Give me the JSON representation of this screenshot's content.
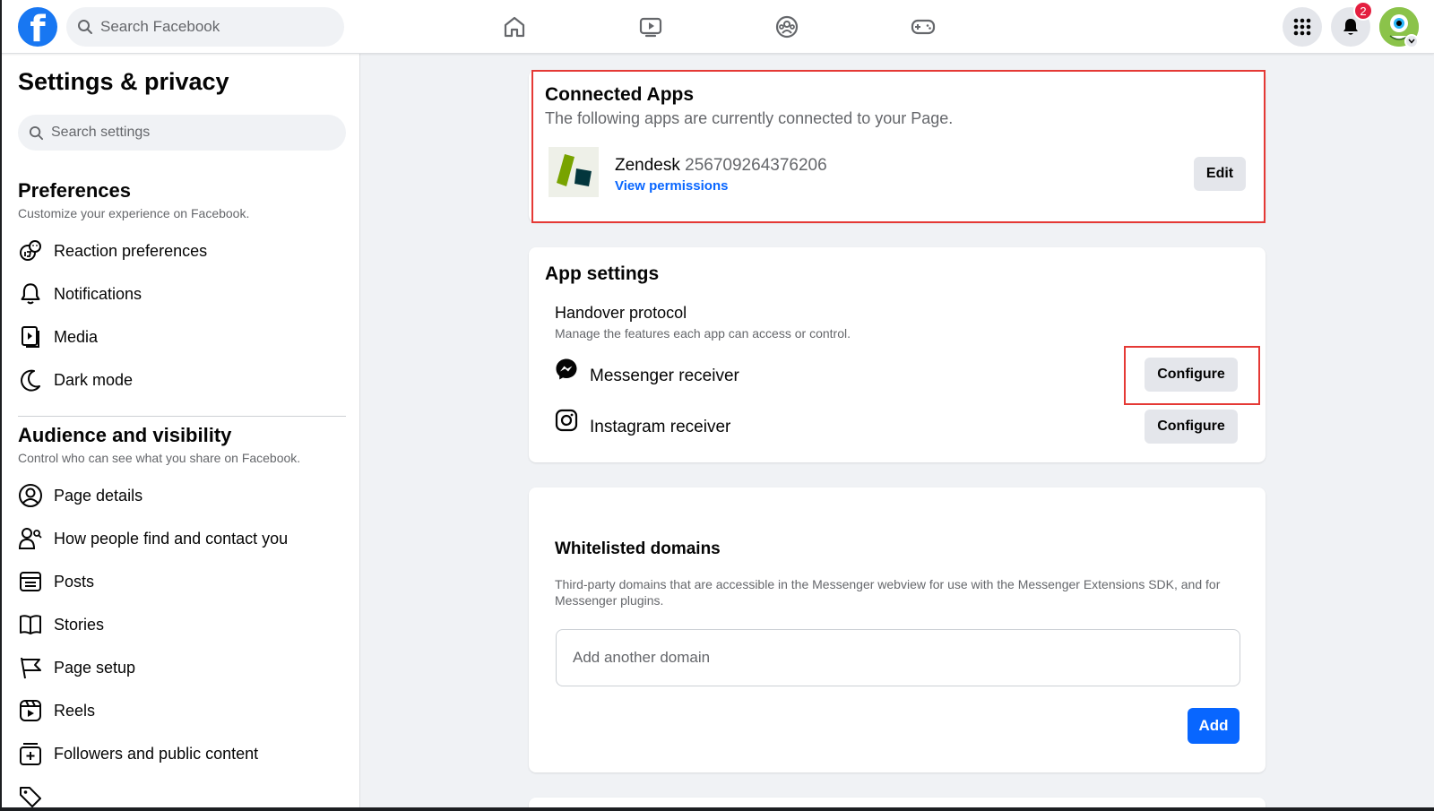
{
  "topbar": {
    "search_placeholder": "Search Facebook",
    "notification_count": "2",
    "nav_icons": [
      "home-icon",
      "video-icon",
      "groups-icon",
      "gaming-icon"
    ],
    "accent_color": "#1877f2"
  },
  "sidebar": {
    "title": "Settings & privacy",
    "search_placeholder": "Search settings",
    "preferences": {
      "heading": "Preferences",
      "subtitle": "Customize your experience on Facebook.",
      "items": [
        {
          "label": "Reaction preferences",
          "icon": "reaction-icon"
        },
        {
          "label": "Notifications",
          "icon": "bell-icon"
        },
        {
          "label": "Media",
          "icon": "media-icon"
        },
        {
          "label": "Dark mode",
          "icon": "moon-icon"
        }
      ]
    },
    "audience": {
      "heading": "Audience and visibility",
      "subtitle": "Control who can see what you share on Facebook.",
      "items": [
        {
          "label": "Page details",
          "icon": "user-circle-icon"
        },
        {
          "label": "How people find and contact you",
          "icon": "people-search-icon"
        },
        {
          "label": "Posts",
          "icon": "posts-icon"
        },
        {
          "label": "Stories",
          "icon": "book-icon"
        },
        {
          "label": "Page setup",
          "icon": "flag-icon"
        },
        {
          "label": "Reels",
          "icon": "reels-icon"
        },
        {
          "label": "Followers and public content",
          "icon": "followers-icon"
        }
      ]
    }
  },
  "connected_apps": {
    "title": "Connected Apps",
    "subtitle": "The following apps are currently connected to your Page.",
    "app": {
      "name": "Zendesk",
      "id": "256709264376206",
      "link": "View permissions"
    },
    "edit_label": "Edit"
  },
  "app_settings": {
    "title": "App settings",
    "handover": {
      "heading": "Handover protocol",
      "subtitle": "Manage the features each app can access or control."
    },
    "receivers": [
      {
        "label": "Messenger receiver",
        "icon": "messenger-icon",
        "button": "Configure"
      },
      {
        "label": "Instagram receiver",
        "icon": "instagram-icon",
        "button": "Configure"
      }
    ]
  },
  "whitelisted": {
    "title": "Whitelisted domains",
    "description": "Third-party domains that are accessible in the Messenger webview for use with the Messenger Extensions SDK, and for Messenger plugins.",
    "input_placeholder": "Add another domain",
    "add_label": "Add"
  },
  "colors": {
    "highlight": "#e53935",
    "primary_button": "#0866ff",
    "link": "#0866ff"
  }
}
